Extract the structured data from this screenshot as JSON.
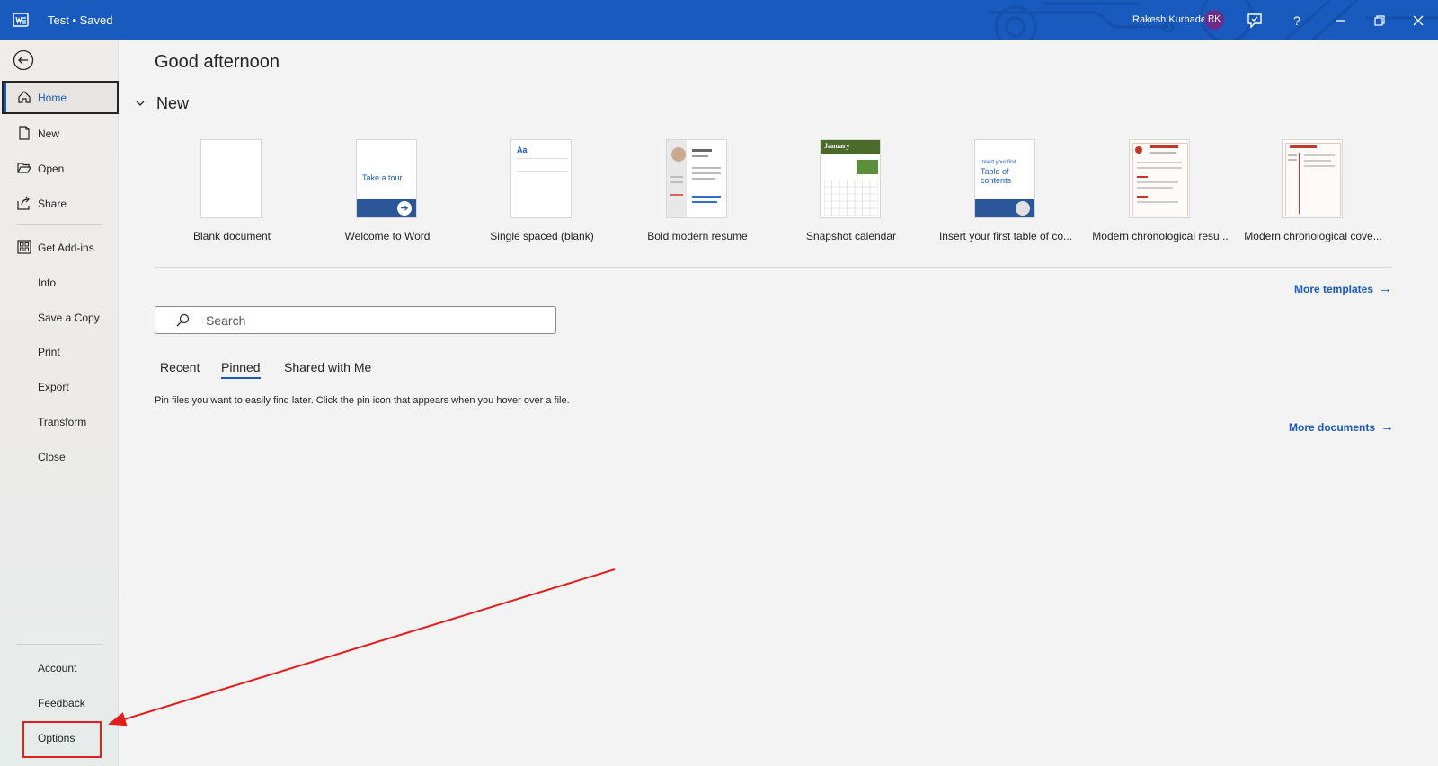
{
  "titlebar": {
    "doc_title": "Test • Saved",
    "user_name": "Rakesh Kurhade",
    "avatar_initials": "RK",
    "help": "?",
    "accent": "#185abd"
  },
  "sidebar": {
    "items": [
      {
        "label": "Home",
        "icon": "home-icon"
      },
      {
        "label": "New",
        "icon": "new-document-icon"
      },
      {
        "label": "Open",
        "icon": "folder-open-icon"
      },
      {
        "label": "Share",
        "icon": "share-icon"
      },
      {
        "label": "Get Add-ins",
        "icon": "add-ins-grid-icon"
      },
      {
        "label": "Info"
      },
      {
        "label": "Save a Copy"
      },
      {
        "label": "Print"
      },
      {
        "label": "Export"
      },
      {
        "label": "Transform"
      },
      {
        "label": "Close"
      }
    ],
    "bottom_items": [
      {
        "label": "Account"
      },
      {
        "label": "Feedback"
      },
      {
        "label": "Options"
      }
    ]
  },
  "main": {
    "greeting": "Good afternoon",
    "new_section_title": "New",
    "templates": [
      {
        "name": "Blank document",
        "thumb_text": ""
      },
      {
        "name": "Welcome to Word",
        "thumb_text": "Take a tour"
      },
      {
        "name": "Single spaced (blank)",
        "thumb_text": "Aa"
      },
      {
        "name": "Bold modern resume",
        "thumb_text": ""
      },
      {
        "name": "Snapshot calendar",
        "thumb_text": "January"
      },
      {
        "name": "Insert your first table of co...",
        "thumb_text_1": "Insert your first",
        "thumb_text_2": "Table of",
        "thumb_text_3": "contents"
      },
      {
        "name": "Modern chronological resu...",
        "thumb_text": ""
      },
      {
        "name": "Modern chronological cove...",
        "thumb_text": ""
      }
    ],
    "more_templates": "More templates",
    "search_placeholder": "Search",
    "tabs": [
      "Recent",
      "Pinned",
      "Shared with Me"
    ],
    "active_tab": "Pinned",
    "pin_message": "Pin files you want to easily find later. Click the pin icon that appears when you hover over a file.",
    "more_documents": "More documents"
  },
  "annotation_color": "#e51c1c"
}
